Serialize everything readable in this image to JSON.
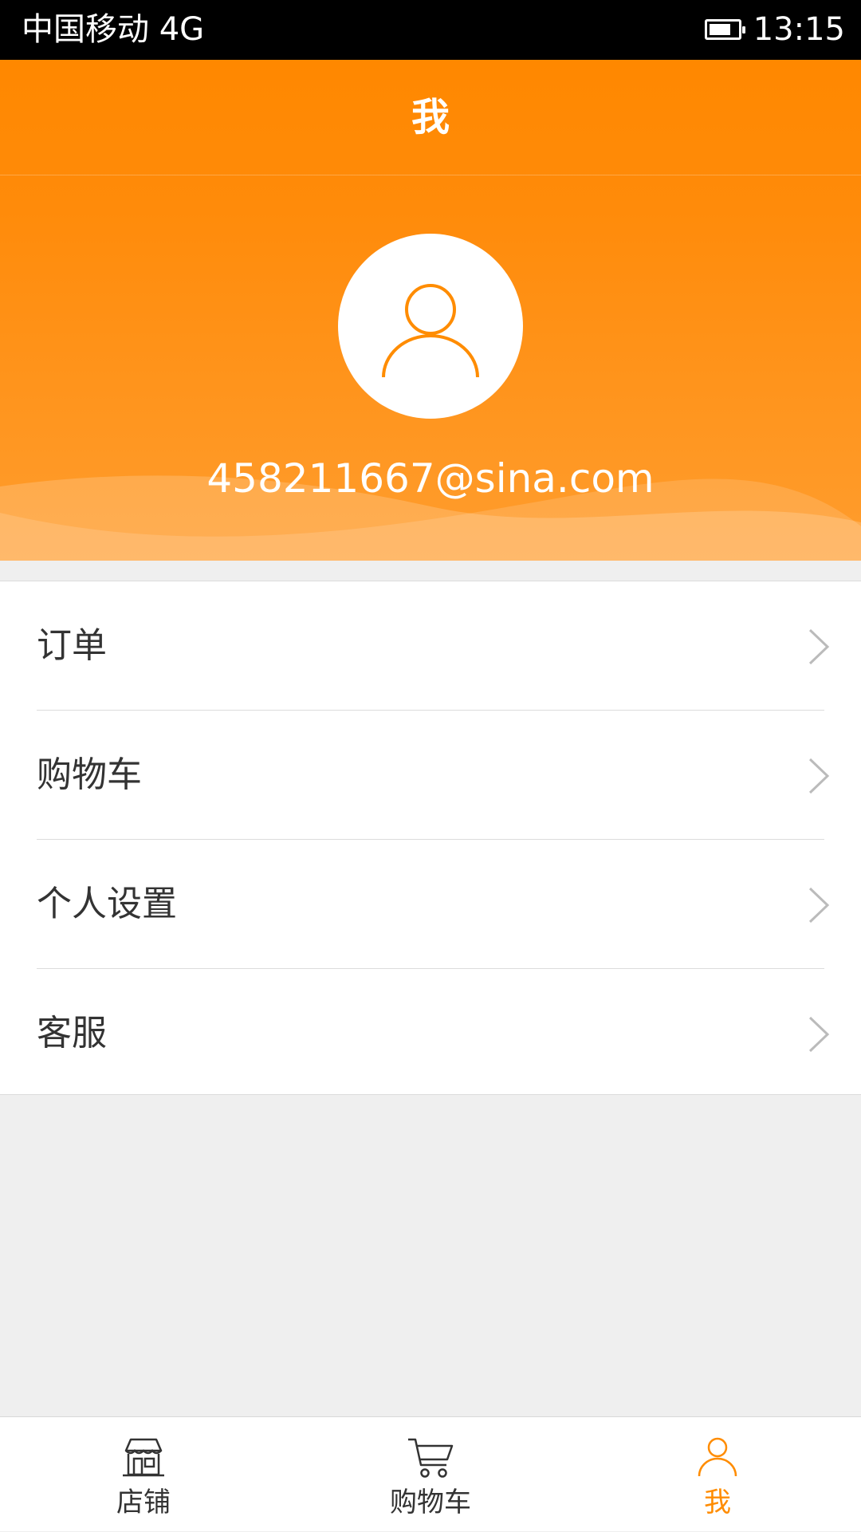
{
  "status_bar": {
    "carrier": "中国移动 4G",
    "time": "13:15",
    "battery_level": 0.75
  },
  "header": {
    "title": "我"
  },
  "profile": {
    "email": "458211667@sina.com",
    "avatar_icon": "user-icon"
  },
  "menu": {
    "items": [
      {
        "label": "订单",
        "icon": "chevron-right-icon"
      },
      {
        "label": "购物车",
        "icon": "chevron-right-icon"
      },
      {
        "label": "个人设置",
        "icon": "chevron-right-icon"
      },
      {
        "label": "客服",
        "icon": "chevron-right-icon"
      }
    ]
  },
  "tab_bar": {
    "tabs": [
      {
        "label": "店铺",
        "icon": "store-icon",
        "active": false
      },
      {
        "label": "购物车",
        "icon": "cart-icon",
        "active": false
      },
      {
        "label": "我",
        "icon": "user-icon",
        "active": true
      }
    ]
  },
  "colors": {
    "accent": "#ff8c00",
    "header_top": "#ff8800",
    "header_bottom": "#ff9d2e",
    "page_background": "#efefef",
    "text": "#333333",
    "chevron": "#bbbbbb"
  }
}
